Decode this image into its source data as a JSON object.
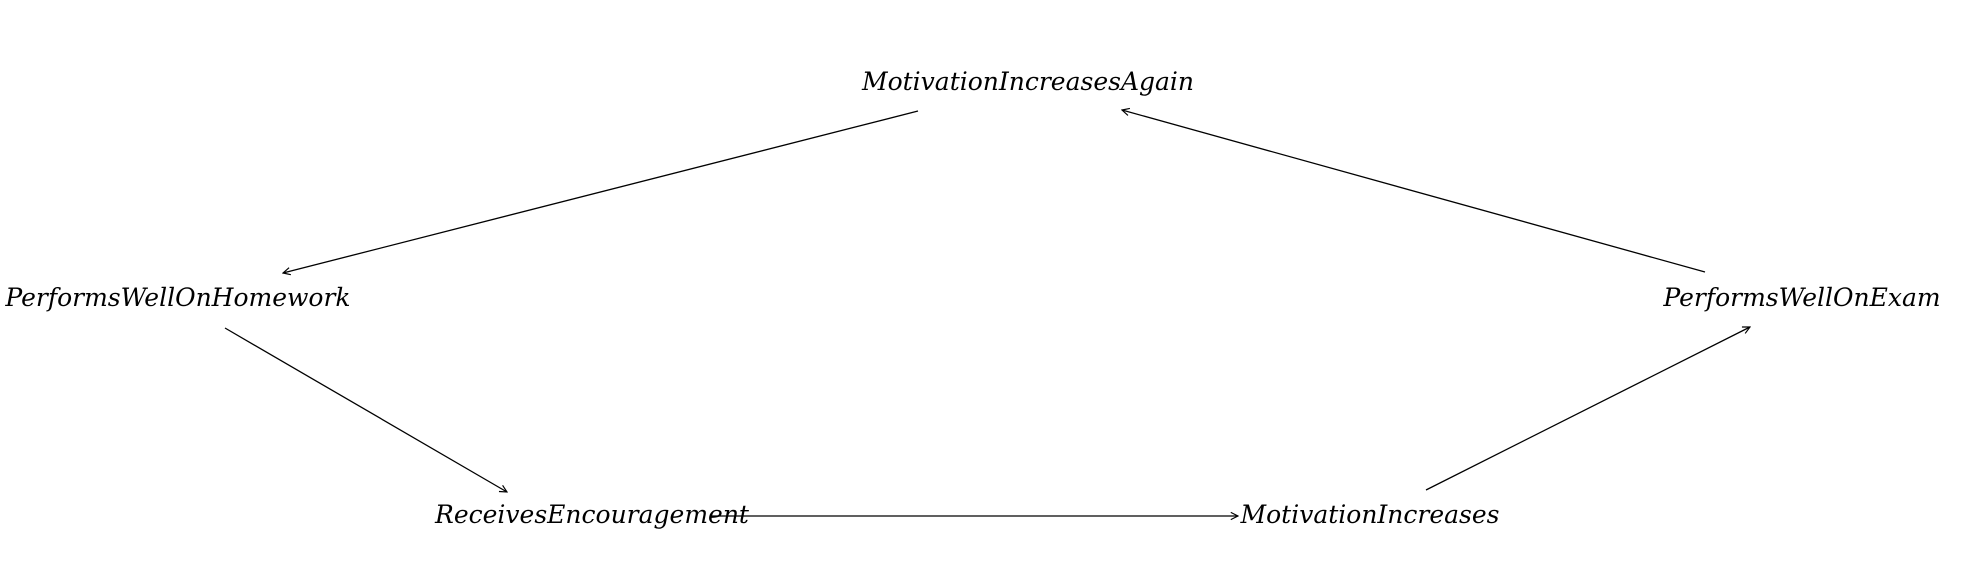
{
  "diagram": {
    "nodes": {
      "motivation_again": {
        "label": "MotivationIncreasesAgain"
      },
      "homework": {
        "label": "PerformsWellOnHomework"
      },
      "exam": {
        "label": "PerformsWellOnExam"
      },
      "encouragement": {
        "label": "ReceivesEncouragement"
      },
      "motivation": {
        "label": "MotivationIncreases"
      }
    },
    "edges": [
      {
        "from": "motivation_again",
        "to": "homework"
      },
      {
        "from": "homework",
        "to": "encouragement"
      },
      {
        "from": "encouragement",
        "to": "motivation"
      },
      {
        "from": "motivation",
        "to": "exam"
      },
      {
        "from": "exam",
        "to": "motivation_again"
      }
    ],
    "colors": {
      "ink": "#000000",
      "background": "#ffffff"
    }
  }
}
